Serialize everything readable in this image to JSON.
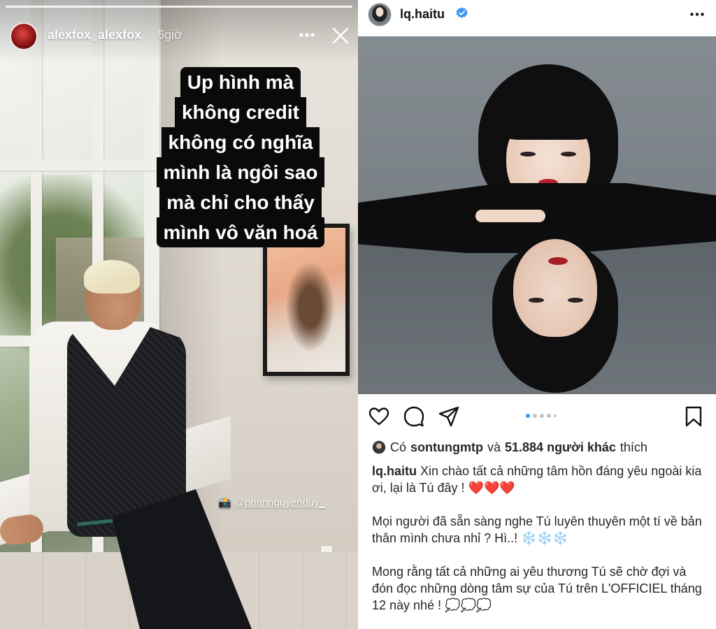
{
  "story": {
    "username": "alexfox_alexfox",
    "time": "6giờ",
    "caption_lines": [
      "Up hình mà",
      "không credit",
      "không có nghĩa",
      "mình là ngôi sao",
      "mà chỉ cho thấy",
      "mình vô văn hoá"
    ],
    "photo_tag": "@phannguyenduy_",
    "tag_icon": "camera-emoji"
  },
  "post": {
    "username": "lq.haitu",
    "verified": true,
    "likes": {
      "prefix": "Có",
      "liker": "sontungmtp",
      "conj": "và",
      "others": "51.884 người khác",
      "suffix": "thích"
    },
    "carousel": {
      "count": 5,
      "active": 0
    },
    "caption": {
      "author": "lq.haitu",
      "p1": "Xin chào tất cả những tâm hồn đáng yêu ngoài kia ơi, lại là Tú đây !",
      "p1_emoji": "❤️❤️❤️",
      "p2": "Mọi người đã sẵn sàng nghe Tú luyên thuyên một tí về bản thân mình chưa nhỉ ? Hì..!",
      "p2_emoji": "❄️❄️❄️",
      "p3": "Mong rằng tất cả những ai yêu thương Tú sẽ chờ đợi và đón đọc những dòng tâm sự của Tú trên L'OFFICIEL tháng 12 này nhé !",
      "p3_emoji": "💭💭💭"
    }
  },
  "colors": {
    "verified_blue": "#3897f0",
    "heart_red": "#e02424",
    "caption_bg": "#0a0a0a"
  }
}
